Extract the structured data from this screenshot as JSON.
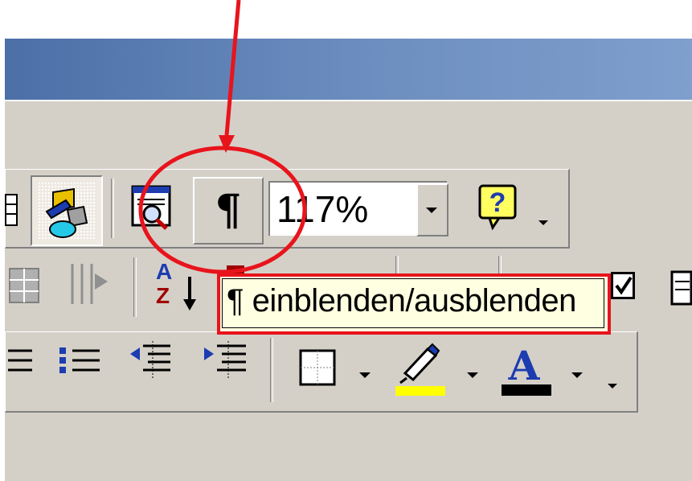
{
  "toolbar_standard": {
    "show_hide_symbol": "¶",
    "zoom_value": "117%"
  },
  "toolbar_formatting": {
    "sort_az_top": "A",
    "sort_az_bottom": "Z"
  },
  "tooltip": {
    "text": "¶ einblenden/ausblenden"
  },
  "colors": {
    "annotation": "#e8141c",
    "highlight": "#ffff00",
    "font_color": "#000000",
    "tooltip_bg": "#ffffe1",
    "titlebar_left": "#4c6fa8",
    "titlebar_right": "#7f9fcd"
  }
}
